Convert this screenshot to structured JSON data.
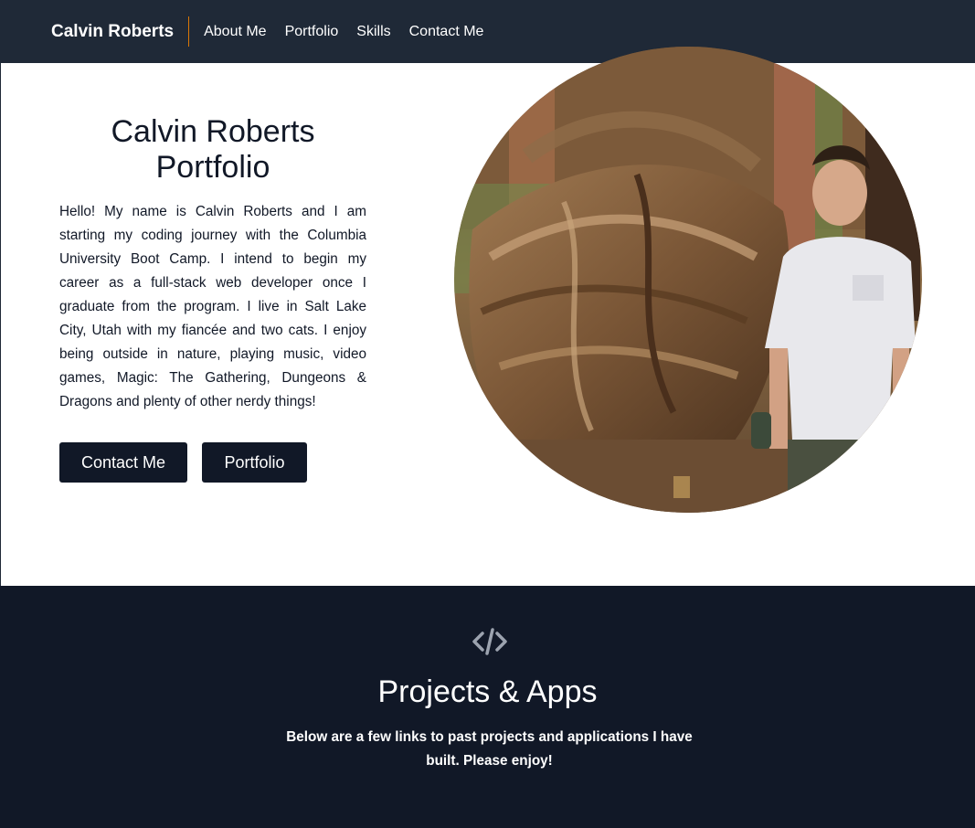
{
  "nav": {
    "brand": "Calvin Roberts",
    "links": [
      "About Me",
      "Portfolio",
      "Skills",
      "Contact Me"
    ]
  },
  "hero": {
    "title_line1": "Calvin Roberts",
    "title_line2": "Portfolio",
    "paragraph": "Hello! My name is Calvin Roberts and I am starting my coding journey with the Columbia University Boot Camp. I intend to begin my career as a full-stack web developer once I graduate from the program. I live in Salt Lake City, Utah with my fiancée and two cats. I enjoy being outside in nature, playing music, video games, Magic: The Gathering, Dungeons & Dragons and plenty of other nerdy things!",
    "contact_button": "Contact Me",
    "portfolio_button": "Portfolio",
    "photo_icon": "profile-photo"
  },
  "projects": {
    "icon": "code-icon",
    "title": "Projects & Apps",
    "description": "Below are a few links to past projects and applications I have built. Please enjoy!"
  },
  "colors": {
    "navbar_bg": "#1f2937",
    "dark_section_bg": "#111827",
    "accent": "#d97706",
    "button_bg": "#111827"
  }
}
